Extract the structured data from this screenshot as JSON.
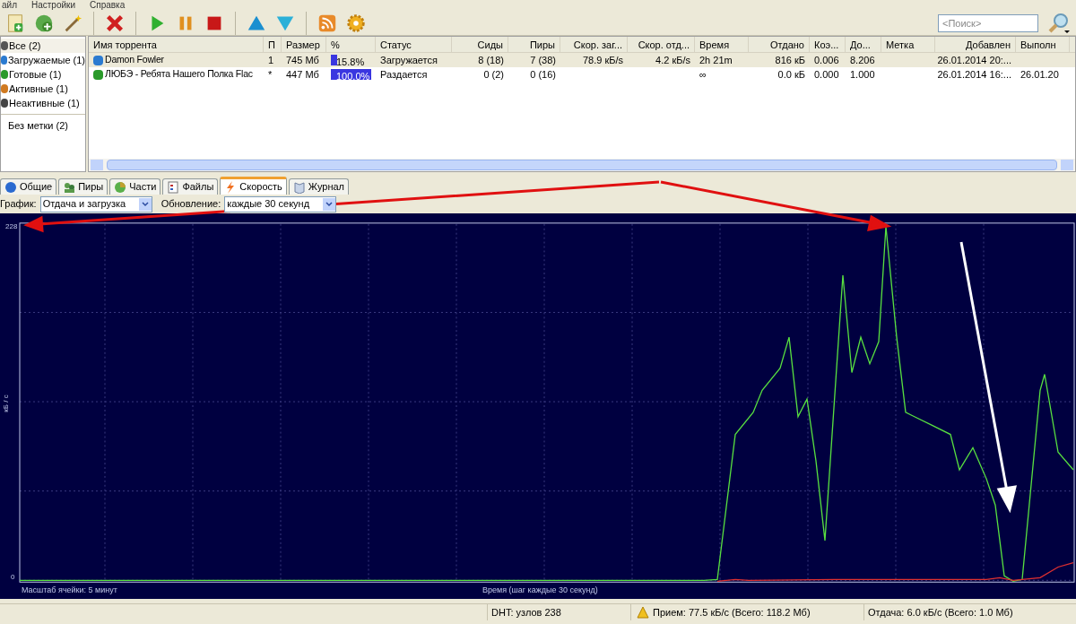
{
  "menu": [
    "айл",
    "Настройки",
    "Справка"
  ],
  "search": {
    "placeholder": "<Поиск>"
  },
  "categories": [
    {
      "label": "Все (2)",
      "selected": true
    },
    {
      "label": "Загружаемые (1)",
      "selected": false
    },
    {
      "label": "Готовые (1)",
      "selected": false
    },
    {
      "label": "Активные (1)",
      "selected": false
    },
    {
      "label": "Неактивные (1)",
      "selected": false
    }
  ],
  "labels": [
    {
      "label": "Без метки (2)",
      "selected": false
    }
  ],
  "table": {
    "columns": [
      "Имя торрента",
      "П",
      "Размер",
      "%",
      "Статус",
      "Сиды",
      "Пиры",
      "Скор. заг...",
      "Скор. отд...",
      "Время",
      "Отдано",
      "Коэ...",
      "До...",
      "Метка",
      "Добавлен",
      "Выполн"
    ],
    "rows": [
      {
        "kind": "down",
        "selected": true,
        "name": "Damon Fowler",
        "p": "1",
        "size": "745 Мб",
        "percent": "15.8%",
        "level": 0.158,
        "status": "Загружается",
        "seeds": "8 (18)",
        "peers": "7 (38)",
        "down": "78.9 кБ/s",
        "up": "4.2 кБ/s",
        "time": "2h 21m",
        "uploaded": "816 кБ",
        "ratio": "0.006",
        "avail": "8.206",
        "added": "26.01.2014 20:..."
      },
      {
        "kind": "up",
        "selected": false,
        "name": "ЛЮБЭ - Ребята Нашего Полка Flac",
        "p": "*",
        "size": "447 Мб",
        "percent": "100.0%",
        "level": 1.0,
        "status": "Раздается",
        "seeds": "0 (2)",
        "peers": "0 (16)",
        "down": "",
        "up": "",
        "time": "∞",
        "uploaded": "0.0 кБ",
        "ratio": "0.000",
        "avail": "1.000",
        "added": "26.01.2014 16:...",
        "done": "26.01.20"
      }
    ]
  },
  "tabs": [
    {
      "label": "Общие",
      "selected": false
    },
    {
      "label": "Пиры",
      "selected": false
    },
    {
      "label": "Части",
      "selected": false
    },
    {
      "label": "Файлы",
      "selected": false
    },
    {
      "label": "Скорость",
      "selected": true
    },
    {
      "label": "Журнал",
      "selected": false
    }
  ],
  "graph": {
    "label": "График:",
    "value": "Отдача и загрузка",
    "update_label": "Обновление:",
    "update_value": "каждые 30 секунд"
  },
  "chart": {
    "y_max": "228",
    "y_min": "0",
    "y_label": "кБ / с",
    "scale": "Масштаб ячейки: 5 минут",
    "x_label": "Время (шаг каждые 30 секунд)"
  },
  "status_bar": {
    "dht": "DHT: узлов 238",
    "down": "Прием: 77.5 кБ/с (Всего: 118.2 Мб)",
    "up": "Отдача: 6.0 кБ/с (Всего: 1.0 Мб)"
  }
}
